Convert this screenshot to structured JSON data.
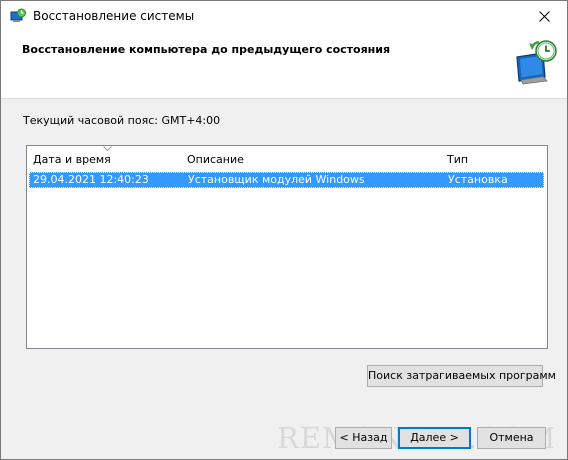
{
  "window": {
    "title": "Восстановление системы",
    "close_symbol": "✕"
  },
  "header": {
    "title": "Восстановление компьютера до предыдущего состояния",
    "icon": "system-restore-icon"
  },
  "timezone": {
    "text": "Текущий часовой пояс: GMT+4:00"
  },
  "restore_list": {
    "columns": [
      "Дата и время",
      "Описание",
      "Тип"
    ],
    "sorted_column": "Дата и время",
    "rows": [
      {
        "date": "29.04.2021 12:40:23",
        "description": "Установщик модулей Windows",
        "type": "Установка",
        "selected": true
      }
    ],
    "selection_color": "#3399ff"
  },
  "buttons": {
    "scan": "Поиск затрагиваемых программ",
    "back": "< Назад",
    "next": "Далее >",
    "cancel": "Отмена"
  },
  "watermark": "REMONTKA.COM",
  "colors": {
    "accent": "#0078d7",
    "background": "#f0f0f0"
  }
}
